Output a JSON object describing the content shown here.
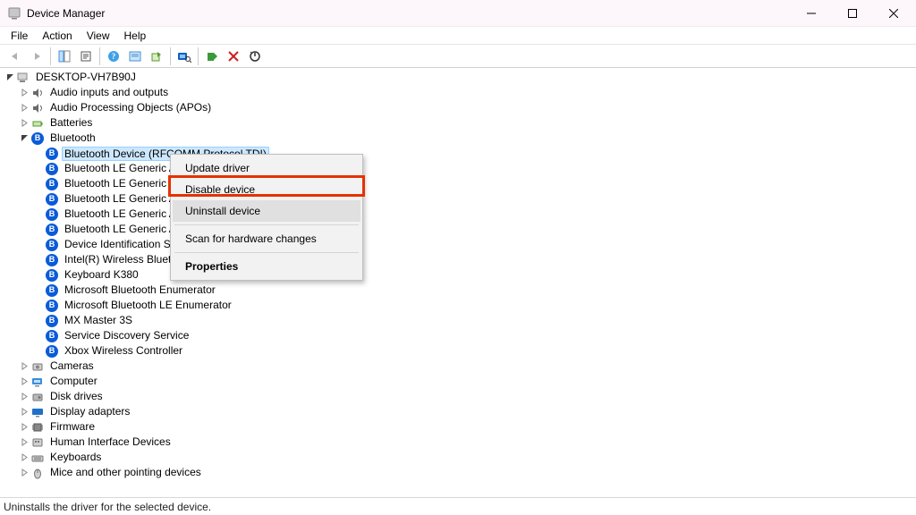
{
  "window": {
    "title": "Device Manager"
  },
  "menu": {
    "file": "File",
    "action": "Action",
    "view": "View",
    "help": "Help"
  },
  "tree": {
    "root": "DESKTOP-VH7B90J",
    "categories": [
      {
        "name": "Audio inputs and outputs",
        "expanded": false,
        "icon": "audio"
      },
      {
        "name": "Audio Processing Objects (APOs)",
        "expanded": false,
        "icon": "audio"
      },
      {
        "name": "Batteries",
        "expanded": false,
        "icon": "battery"
      },
      {
        "name": "Bluetooth",
        "expanded": true,
        "icon": "bt",
        "children": [
          "Bluetooth Device (RFCOMM Protocol TDI)",
          "Bluetooth LE Generic Attribute Service",
          "Bluetooth LE Generic Attribute Service",
          "Bluetooth LE Generic Attribute Service",
          "Bluetooth LE Generic Attribute Service",
          "Bluetooth LE Generic Attribute Service",
          "Device Identification Service",
          "Intel(R) Wireless Bluetooth(R)",
          "Keyboard K380",
          "Microsoft Bluetooth Enumerator",
          "Microsoft Bluetooth LE Enumerator",
          "MX Master 3S",
          "Service Discovery Service",
          "Xbox Wireless Controller"
        ],
        "selected_index": 0
      },
      {
        "name": "Cameras",
        "expanded": false,
        "icon": "camera"
      },
      {
        "name": "Computer",
        "expanded": false,
        "icon": "computer"
      },
      {
        "name": "Disk drives",
        "expanded": false,
        "icon": "disk"
      },
      {
        "name": "Display adapters",
        "expanded": false,
        "icon": "display"
      },
      {
        "name": "Firmware",
        "expanded": false,
        "icon": "firmware"
      },
      {
        "name": "Human Interface Devices",
        "expanded": false,
        "icon": "hid"
      },
      {
        "name": "Keyboards",
        "expanded": false,
        "icon": "keyboard"
      },
      {
        "name": "Mice and other pointing devices",
        "expanded": false,
        "icon": "mouse"
      }
    ]
  },
  "context_menu": {
    "update_driver": "Update driver",
    "disable_device": "Disable device",
    "uninstall_device": "Uninstall device",
    "scan": "Scan for hardware changes",
    "properties": "Properties"
  },
  "status": {
    "text": "Uninstalls the driver for the selected device."
  }
}
